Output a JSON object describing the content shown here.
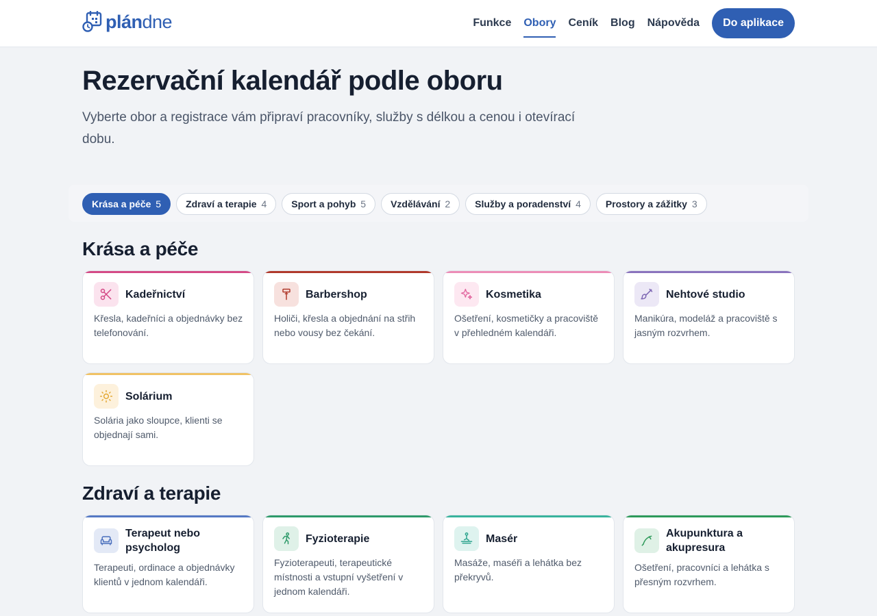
{
  "header": {
    "logo_bold": "plán",
    "logo_light": "dne",
    "nav": [
      {
        "label": "Funkce",
        "active": false
      },
      {
        "label": "Obory",
        "active": true
      },
      {
        "label": "Ceník",
        "active": false
      },
      {
        "label": "Blog",
        "active": false
      },
      {
        "label": "Nápověda",
        "active": false
      }
    ],
    "cta": "Do aplikace"
  },
  "hero": {
    "title": "Rezervační kalendář podle oboru",
    "subtitle": "Vyberte obor a registrace vám připraví pracovníky, služby s délkou a cenou i otevírací dobu."
  },
  "filters": [
    {
      "label": "Krása a péče",
      "count": "5",
      "active": true
    },
    {
      "label": "Zdraví a terapie",
      "count": "4",
      "active": false
    },
    {
      "label": "Sport a pohyb",
      "count": "5",
      "active": false
    },
    {
      "label": "Vzdělávání",
      "count": "2",
      "active": false
    },
    {
      "label": "Služby a poradenství",
      "count": "4",
      "active": false
    },
    {
      "label": "Prostory a zážitky",
      "count": "3",
      "active": false
    }
  ],
  "sections": [
    {
      "title": "Krása a péče",
      "cards": [
        {
          "title": "Kadeřnictví",
          "desc": "Křesla, kadeřníci a objednávky bez telefonování.",
          "icon": "scissors-icon",
          "accent": "#d44a86",
          "tint": "#fbe3ee"
        },
        {
          "title": "Barbershop",
          "desc": "Holiči, křesla a objednání na střih nebo vousy bez čekání.",
          "icon": "razor-icon",
          "accent": "#b0392b",
          "tint": "#f7e1de"
        },
        {
          "title": "Kosmetika",
          "desc": "Ošetření, kosmetičky a pracoviště v přehledném kalendáři.",
          "icon": "sparkle-icon",
          "accent": "#ec8cb7",
          "tint": "#fde8f1"
        },
        {
          "title": "Nehtové studio",
          "desc": "Manikúra, modeláž a pracoviště s jasným rozvrhem.",
          "icon": "brush-icon",
          "accent": "#8a73bd",
          "tint": "#ece8f6"
        },
        {
          "title": "Solárium",
          "desc": "Solária jako sloupce, klienti se objednají sami.",
          "icon": "sun-icon",
          "accent": "#f0c265",
          "tint": "#fdf1dc"
        }
      ]
    },
    {
      "title": "Zdraví a terapie",
      "cards": [
        {
          "title": "Terapeut nebo psycholog",
          "desc": "Terapeuti, ordinace a objednávky klientů v jednom kalendáři.",
          "icon": "sofa-icon",
          "accent": "#5579c4",
          "tint": "#e3e9f6"
        },
        {
          "title": "Fyzioterapie",
          "desc": "Fyzioterapeuti, terapeutické místnosti a vstupní vyšetření v jednom kalendáři.",
          "icon": "person-running-icon",
          "accent": "#2e9a6a",
          "tint": "#dff1e8"
        },
        {
          "title": "Masér",
          "desc": "Masáže, maséři a lehátka bez překryvů.",
          "icon": "massage-icon",
          "accent": "#39b39d",
          "tint": "#def3ef"
        },
        {
          "title": "Akupunktura a akupresura",
          "desc": "Ošetření, pracovníci a lehátka s přesným rozvrhem.",
          "icon": "needle-icon",
          "accent": "#2e9a5a",
          "tint": "#dff1e6"
        }
      ]
    }
  ]
}
